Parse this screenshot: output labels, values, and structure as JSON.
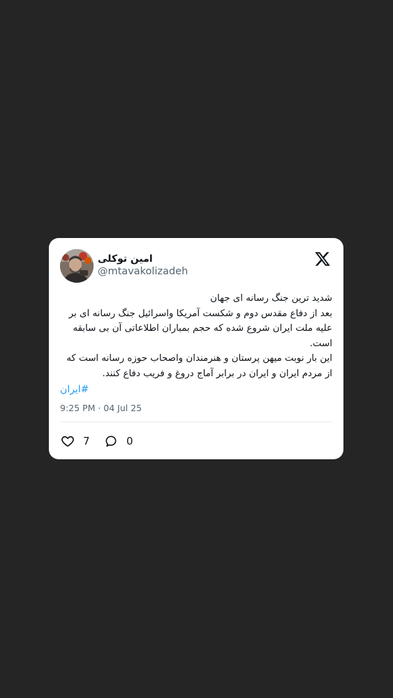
{
  "tweet": {
    "author_name": "امین توکلی",
    "handle": "@mtavakolizadeh",
    "lines": [
      "شدید ترین جنگ رسانه ای جهان",
      "بعد از دفاع مقدس دوم و شکست آمریکا واسرائیل جنگ رسانه ای بر",
      "علیه ملت ایران شروع شده که حجم بمباران اطلاعاتی آن بی سابقه",
      "است.",
      "این بار نوبت میهن پرستان و هنرمندان واصحاب حوزه رسانه است که",
      "از مردم ایران و ایران در برابر آماج دروغ و فریب دفاع کنند."
    ],
    "hashtag": "#ایران",
    "timestamp": "9:25 PM · 04 Jul 25",
    "likes": "7",
    "replies": "0"
  },
  "colors": {
    "background": "#252525",
    "card": "#ffffff",
    "hashtag": "#1d9bf0",
    "muted": "#536471"
  },
  "icons": [
    "avatar-photo",
    "x-logo-icon",
    "heart-icon",
    "reply-bubble-icon"
  ]
}
